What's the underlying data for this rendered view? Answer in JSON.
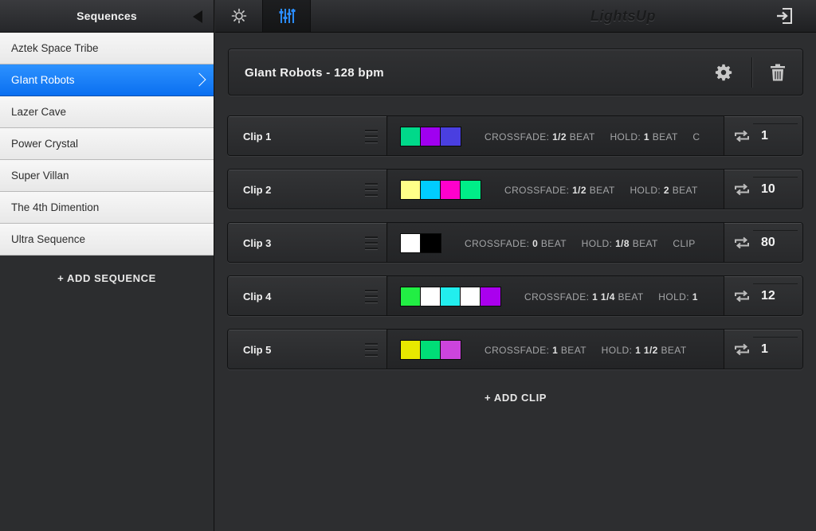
{
  "sidebar": {
    "title": "Sequences",
    "items": [
      {
        "label": "Aztek Space Tribe"
      },
      {
        "label": "GIant Robots"
      },
      {
        "label": "Lazer Cave"
      },
      {
        "label": "Power Crystal"
      },
      {
        "label": "Super Villan"
      },
      {
        "label": "The 4th Dimention"
      },
      {
        "label": "Ultra Sequence"
      }
    ],
    "active_index": 1,
    "add_label": "+ ADD SEQUENCE"
  },
  "topbar": {
    "app_title": "LightsUp",
    "tabs": [
      {
        "icon": "sun-icon",
        "active": false
      },
      {
        "icon": "mixer-sliders-icon",
        "active": true
      }
    ],
    "exit_icon": "exit-icon"
  },
  "sequence": {
    "title": "GIant Robots - 128 bpm"
  },
  "clips": [
    {
      "name": "Clip 1",
      "colors": [
        "#00d98a",
        "#a000f0",
        "#4a3fe0"
      ],
      "crossfade_label": "CROSSFADE:",
      "crossfade": "1/2",
      "crossfade_unit": "BEAT",
      "hold_label": "HOLD:",
      "hold": "1",
      "hold_unit": "BEAT",
      "extra": "C",
      "repeat": "1"
    },
    {
      "name": "Clip 2",
      "colors": [
        "#ffff88",
        "#00ccff",
        "#ff00cc",
        "#00ee88"
      ],
      "crossfade_label": "CROSSFADE:",
      "crossfade": "1/2",
      "crossfade_unit": "BEAT",
      "hold_label": "HOLD:",
      "hold": "2",
      "hold_unit": "BEAT",
      "extra": "",
      "repeat": "10"
    },
    {
      "name": "Clip 3",
      "colors": [
        "#ffffff",
        "#000000"
      ],
      "crossfade_label": "CROSSFADE:",
      "crossfade": "0",
      "crossfade_unit": "BEAT",
      "hold_label": "HOLD:",
      "hold": "1/8",
      "hold_unit": "BEAT",
      "extra": "CLIP",
      "repeat": "80"
    },
    {
      "name": "Clip 4",
      "colors": [
        "#22ee44",
        "#ffffff",
        "#22eeee",
        "#ffffff",
        "#aa00ee"
      ],
      "crossfade_label": "CROSSFADE:",
      "crossfade": "1 1/4",
      "crossfade_unit": "BEAT",
      "hold_label": "HOLD:",
      "hold": "1",
      "hold_unit": "",
      "extra": "",
      "repeat": "12"
    },
    {
      "name": "Clip 5",
      "colors": [
        "#e8e800",
        "#00dd77",
        "#cc44dd"
      ],
      "crossfade_label": "CROSSFADE:",
      "crossfade": "1",
      "crossfade_unit": "BEAT",
      "hold_label": "HOLD:",
      "hold": "1 1/2",
      "hold_unit": "BEAT",
      "extra": "",
      "repeat": "1"
    }
  ],
  "add_clip_label": "+ ADD CLIP"
}
